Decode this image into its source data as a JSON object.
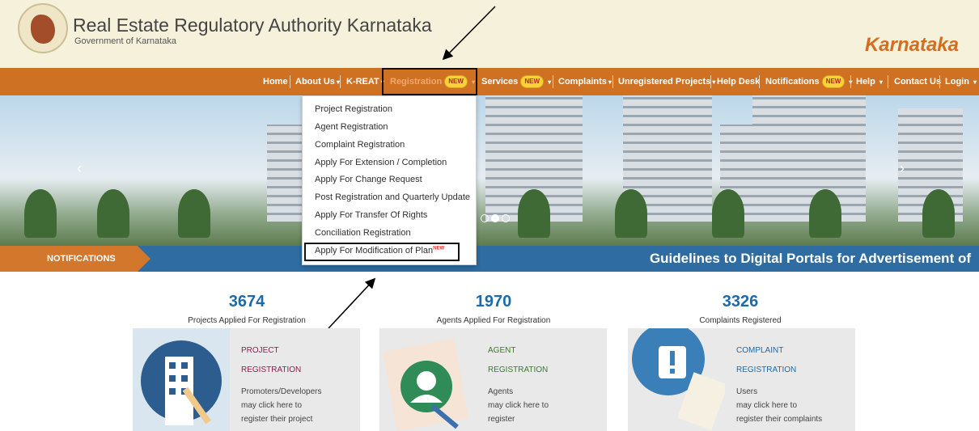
{
  "header": {
    "title": "Real Estate Regulatory Authority Karnataka",
    "subtitle": "Government of Karnataka",
    "state": "Karnataka"
  },
  "nav": {
    "home": "Home",
    "about": "About Us",
    "kreat": "K-REAT",
    "registration": "Registration",
    "services": "Services",
    "complaints": "Complaints",
    "unregistered": "Unregistered Projects",
    "helpdesk": "Help Desk",
    "notifications": "Notifications",
    "help": "Help",
    "contact": "Contact Us",
    "login": "Login",
    "new_badge": "NEW"
  },
  "dropdown": {
    "items": [
      "Project Registration",
      "Agent Registration",
      "Complaint Registration",
      "Apply For Extension / Completion",
      "Apply For Change Request",
      "Post Registration and Quarterly Update",
      "Apply For Transfer Of Rights",
      "Conciliation Registration",
      "Apply For Modification of Plan"
    ],
    "new_tag": "NEW"
  },
  "notifications_bar": {
    "label": "NOTIFICATIONS",
    "ticker": "Guidelines to Digital Portals for Advertisement of"
  },
  "stats": [
    {
      "value": "3674",
      "label": "Projects Applied For Registration"
    },
    {
      "value": "1970",
      "label": "Agents Applied For Registration"
    },
    {
      "value": "3326",
      "label": "Complaints Registered"
    }
  ],
  "cards": [
    {
      "title1": "PROJECT",
      "title2": "REGISTRATION",
      "l1": "Promoters/Developers",
      "l2": "may click here to",
      "l3": "register their project",
      "color": "#8e1f4f"
    },
    {
      "title1": "AGENT",
      "title2": "REGISTRATION",
      "l1": "Agents",
      "l2": "may click here to",
      "l3": "register",
      "color": "#3c7a2e"
    },
    {
      "title1": "COMPLAINT",
      "title2": "REGISTRATION",
      "l1": "Users",
      "l2": "may click here to",
      "l3": "register their complaints",
      "color": "#1e6aa8"
    }
  ],
  "colors": {
    "nav": "#cf7123",
    "notification_bar": "#2e6ca2",
    "accent": "#d46d1f"
  }
}
